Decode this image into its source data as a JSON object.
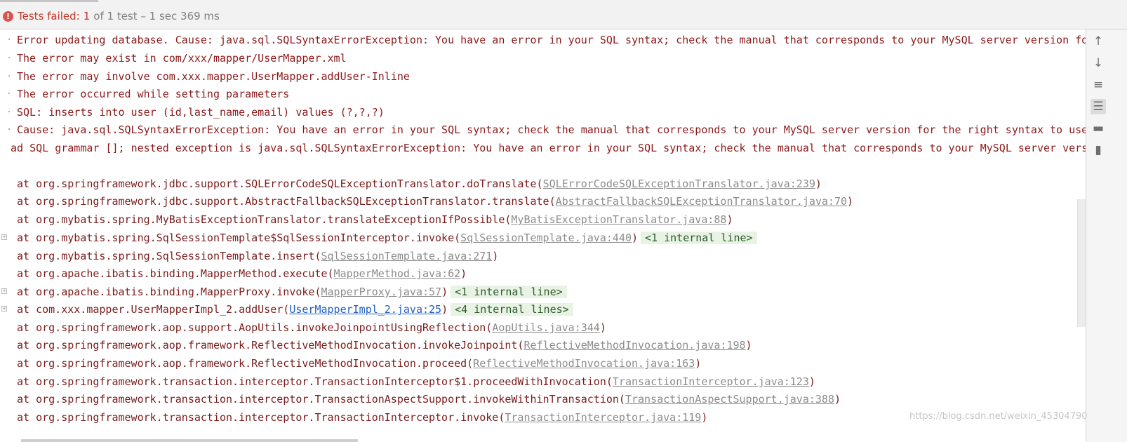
{
  "header": {
    "status_label": "Tests failed:",
    "failed_count": "1",
    "status_rest": "of 1 test – 1 sec 369 ms"
  },
  "console": {
    "error_lines": [
      "Error updating database.  Cause: java.sql.SQLSyntaxErrorException: You have an error in your SQL syntax; check the manual that corresponds to your MySQL server version for th",
      "The error may exist in com/xxx/mapper/UserMapper.xml",
      "The error may involve com.xxx.mapper.UserMapper.addUser-Inline",
      "The error occurred while setting parameters",
      "SQL: inserts into user (id,last_name,email) values (?,?,?)",
      "Cause: java.sql.SQLSyntaxErrorException: You have an error in your SQL syntax; check the manual that corresponds to your MySQL server version for the right syntax to use near",
      "ad SQL grammar []; nested exception is java.sql.SQLSyntaxErrorException: You have an error in your SQL syntax; check the manual that corresponds to your MySQL server version f"
    ],
    "stack": [
      {
        "method": "at org.springframework.jdbc.support.SQLErrorCodeSQLExceptionTranslator.doTranslate(",
        "link": "SQLErrorCodeSQLExceptionTranslator.java:239",
        "internal": ""
      },
      {
        "method": "at org.springframework.jdbc.support.AbstractFallbackSQLExceptionTranslator.translate(",
        "link": "AbstractFallbackSQLExceptionTranslator.java:70",
        "internal": ""
      },
      {
        "method": "at org.mybatis.spring.MyBatisExceptionTranslator.translateExceptionIfPossible(",
        "link": "MyBatisExceptionTranslator.java:88",
        "internal": ""
      },
      {
        "method": "at org.mybatis.spring.SqlSessionTemplate$SqlSessionInterceptor.invoke(",
        "link": "SqlSessionTemplate.java:440",
        "internal": "<1 internal line>"
      },
      {
        "method": "at org.mybatis.spring.SqlSessionTemplate.insert(",
        "link": "SqlSessionTemplate.java:271",
        "internal": ""
      },
      {
        "method": "at org.apache.ibatis.binding.MapperMethod.execute(",
        "link": "MapperMethod.java:62",
        "internal": ""
      },
      {
        "method": "at org.apache.ibatis.binding.MapperProxy.invoke(",
        "link": "MapperProxy.java:57",
        "internal": "<1 internal line>"
      },
      {
        "method": "at com.xxx.mapper.UserMapperImpl_2.addUser(",
        "link": "UserMapperImpl_2.java:25",
        "internal": "<4 internal lines>"
      },
      {
        "method": "at org.springframework.aop.support.AopUtils.invokeJoinpointUsingReflection(",
        "link": "AopUtils.java:344",
        "internal": ""
      },
      {
        "method": "at org.springframework.aop.framework.ReflectiveMethodInvocation.invokeJoinpoint(",
        "link": "ReflectiveMethodInvocation.java:198",
        "internal": ""
      },
      {
        "method": "at org.springframework.aop.framework.ReflectiveMethodInvocation.proceed(",
        "link": "ReflectiveMethodInvocation.java:163",
        "internal": ""
      },
      {
        "method": "at org.springframework.transaction.interceptor.TransactionInterceptor$1.proceedWithInvocation(",
        "link": "TransactionInterceptor.java:123",
        "internal": ""
      },
      {
        "method": "at org.springframework.transaction.interceptor.TransactionAspectSupport.invokeWithinTransaction(",
        "link": "TransactionAspectSupport.java:388",
        "internal": ""
      },
      {
        "method": "at org.springframework.transaction.interceptor.TransactionInterceptor.invoke(",
        "link": "TransactionInterceptor.java:119",
        "internal": ""
      }
    ],
    "close_paren": ")"
  },
  "toolbar": {
    "icons": [
      "arrow-up-icon",
      "arrow-down-icon",
      "soft-wrap-icon",
      "scroll-to-end-icon",
      "print-icon",
      "trash-icon"
    ]
  },
  "watermark": "https://blog.csdn.net/weixin_45304790",
  "colors": {
    "error_text": "#8b1a1a",
    "fail_badge": "#d9534f",
    "link_gray": "#8c8c8c",
    "link_active": "#1f5fbf",
    "internal_bg": "#e8f3e4"
  }
}
